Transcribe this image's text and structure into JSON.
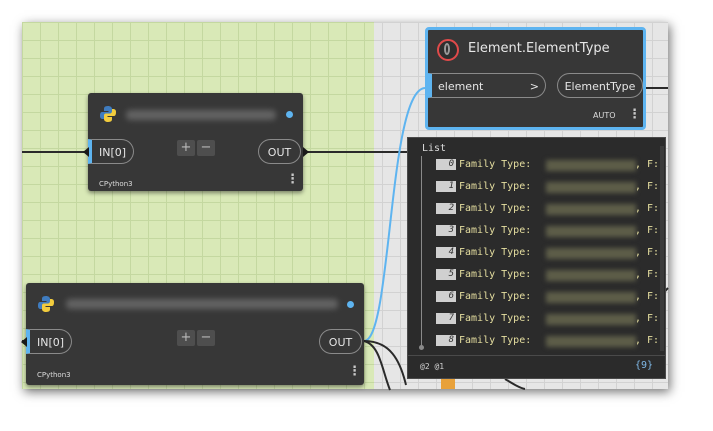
{
  "element_type_node": {
    "title": "Element.ElementType",
    "input_port": "element",
    "input_caret": ">",
    "output_port": "ElementType",
    "lacing": "AUTO",
    "menu": "⋮"
  },
  "python_node_1": {
    "input_port": "IN[0]",
    "output_port": "OUT",
    "add": "+",
    "remove": "−",
    "engine": "CPython3",
    "menu": "⋮"
  },
  "python_node_2": {
    "input_port": "IN[0]",
    "output_port": "OUT",
    "add": "+",
    "remove": "−",
    "engine": "CPython3",
    "menu": "⋮"
  },
  "watch_list": {
    "header": "List",
    "items": [
      {
        "index": "0",
        "label": "Family Type:",
        "suffix": ", F:"
      },
      {
        "index": "1",
        "label": "Family Type:",
        "suffix": ", F:"
      },
      {
        "index": "2",
        "label": "Family Type:",
        "suffix": ", F:"
      },
      {
        "index": "3",
        "label": "Family Type:",
        "suffix": ", F:"
      },
      {
        "index": "4",
        "label": "Family Type:",
        "suffix": ", F:"
      },
      {
        "index": "5",
        "label": "Family Type:",
        "suffix": ", F:"
      },
      {
        "index": "6",
        "label": "Family Type:",
        "suffix": ", F:"
      },
      {
        "index": "7",
        "label": "Family Type:",
        "suffix": ", F:"
      },
      {
        "index": "8",
        "label": "Family Type:",
        "suffix": ", F:"
      }
    ],
    "levels": "@2 @1",
    "count": "{9}"
  },
  "colors": {
    "accent": "#5eb4f0",
    "node_bg": "#373737",
    "group_bg": "#d9e9b7",
    "list_text": "#e6dfa0"
  }
}
